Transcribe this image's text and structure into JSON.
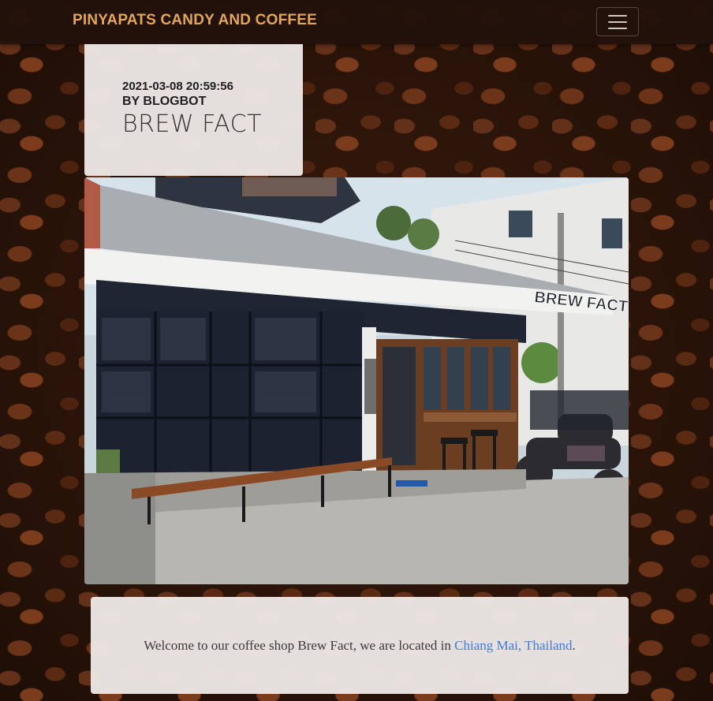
{
  "navbar": {
    "brand": "PINYAPATS CANDY AND COFFEE",
    "toggler_icon": "hamburger-menu-icon",
    "brand_color": "#e0a75a"
  },
  "post": {
    "date": "2021-03-08 20:59:56",
    "author": "BY BLOGBOT",
    "title": "BREW FACT",
    "image_sign_text": "BREW FACT"
  },
  "content": {
    "text_before": "Welcome to our coffee shop Brew Fact, we are located in ",
    "link_text": "Chiang Mai, Thailand",
    "text_after": ".",
    "link_color": "#3f7bd9"
  }
}
